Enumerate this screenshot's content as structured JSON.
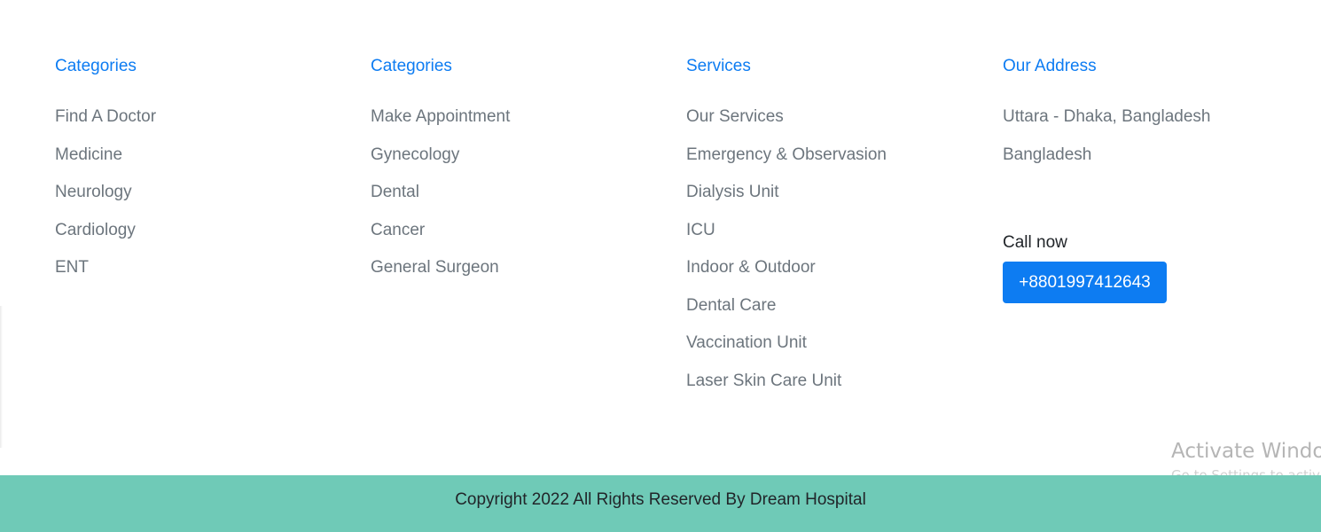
{
  "columns": [
    {
      "heading": "Categories",
      "links": [
        "Find A Doctor",
        "Medicine",
        "Neurology",
        "Cardiology",
        "ENT"
      ]
    },
    {
      "heading": "Categories",
      "links": [
        "Make Appointment",
        "Gynecology",
        "Dental",
        "Cancer",
        "General Surgeon"
      ]
    },
    {
      "heading": "Services",
      "links": [
        "Our Services",
        "Emergency & Observasion",
        "Dialysis Unit",
        "ICU",
        "Indoor & Outdoor",
        "Dental Care",
        "Vaccination Unit",
        "Laser Skin Care Unit"
      ]
    }
  ],
  "address": {
    "heading": "Our Address",
    "lines": [
      "Uttara - Dhaka, Bangladesh",
      "Bangladesh"
    ],
    "call_label": "Call now",
    "phone": "+8801997412643"
  },
  "watermark": {
    "title": "Activate Windows",
    "subtitle": "Go to Settings to activate Windows."
  },
  "copyright": "Copyright 2022 All Rights Reserved By Dream Hospital",
  "colors": {
    "heading": "#0d7cf2",
    "link": "#6c757d",
    "button": "#0d7cf2",
    "footer_bar": "#6fcab7"
  }
}
